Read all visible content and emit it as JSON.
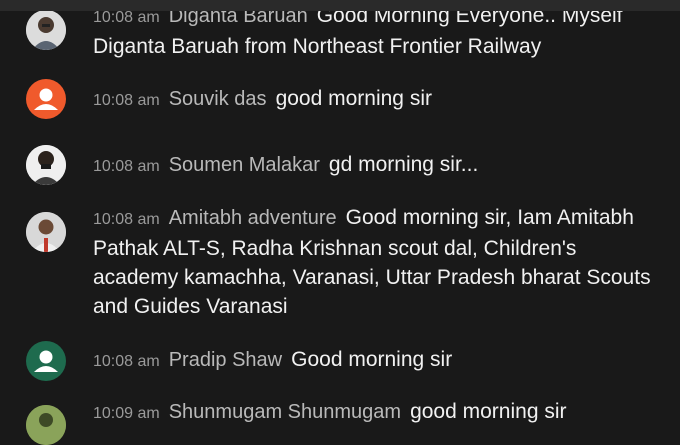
{
  "messages": [
    {
      "time": "10:08 am",
      "author": "Diganta Baruah",
      "text": "Good Morning Everyone.. Myself Diganta Baruah from Northeast Frontier Railway",
      "avatar": "photo",
      "avatar_color": "#6b6f74"
    },
    {
      "time": "10:08 am",
      "author": "Souvik das",
      "text": "good morning sir",
      "avatar": "default-user-icon",
      "avatar_color": "#f05a2c"
    },
    {
      "time": "10:08 am",
      "author": "Soumen Malakar",
      "text": "gd morning sir...",
      "avatar": "photo",
      "avatar_color": "#3b3b3b"
    },
    {
      "time": "10:08 am",
      "author": "Amitabh adventure",
      "text": "Good morning sir, Iam Amitabh Pathak ALT-S, Radha Krishnan scout dal, Children's academy kamachha, Varanasi, Uttar Pradesh bharat Scouts and Guides Varanasi",
      "avatar": "photo",
      "avatar_color": "#d9d9d9"
    },
    {
      "time": "10:08 am",
      "author": "Pradip Shaw",
      "text": "Good morning sir",
      "avatar": "default-user-icon",
      "avatar_color": "#1e6b4e"
    },
    {
      "time": "10:09 am",
      "author": "Shunmugam Shunmugam",
      "text": "good morning sir",
      "avatar": "photo",
      "avatar_color": "#8aa35a"
    }
  ]
}
